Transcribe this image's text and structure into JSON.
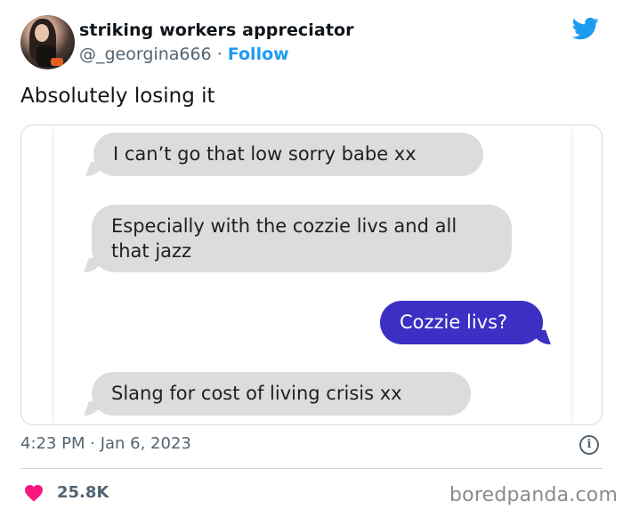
{
  "author": {
    "display_name": "striking workers appreciator",
    "handle": "@_georgina666",
    "separator": "·",
    "follow_label": "Follow"
  },
  "tweet": {
    "text": "Absolutely losing it",
    "timestamp": "4:23 PM · Jan 6, 2023",
    "likes": "25.8K"
  },
  "media": {
    "messages": [
      {
        "direction": "received",
        "text": "I can’t go that low sorry babe xx"
      },
      {
        "direction": "received",
        "text": "Especially with the cozzie livs and all that jazz"
      },
      {
        "direction": "sent",
        "text": "Cozzie livs?"
      },
      {
        "direction": "received",
        "text": "Slang for cost of living crisis xx"
      }
    ]
  },
  "icons": {
    "brand": "twitter-bird-icon",
    "info": "info-icon",
    "like": "heart-icon",
    "info_glyph": "i"
  },
  "colors": {
    "twitter_blue": "#1d9bf0",
    "sent_bubble": "#3b2fc4",
    "received_bubble": "#dcdcdc",
    "like_red": "#f91880",
    "muted_text": "#536471"
  },
  "watermark": "boredpanda.com"
}
